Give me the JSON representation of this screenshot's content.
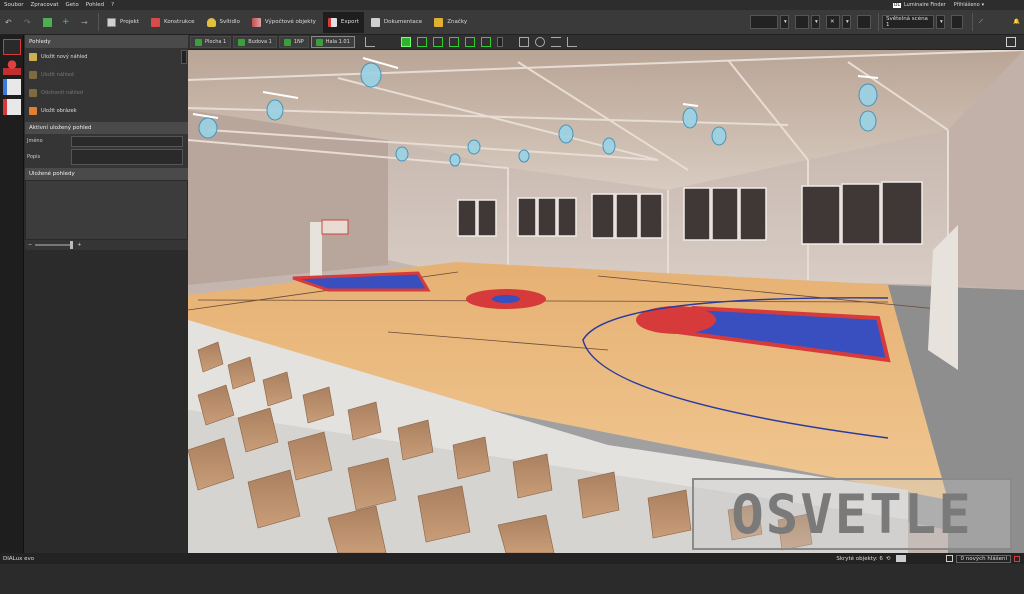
{
  "menu": {
    "items": [
      "Soubor",
      "Zpracovat",
      "Geto",
      "Pohled",
      "?"
    ]
  },
  "toolbar": {
    "tabs": [
      {
        "label": "Projekt",
        "icon": "project-icon",
        "color": "#d0d0d0"
      },
      {
        "label": "Konstrukce",
        "icon": "construction-icon",
        "color": "#d94a4a"
      },
      {
        "label": "Svítidlo",
        "icon": "luminaire-icon",
        "color": "#e0c040"
      },
      {
        "label": "Výpočtové objekty",
        "icon": "calc-objects-icon",
        "color": "#c05050"
      },
      {
        "label": "Export",
        "icon": "export-icon",
        "color": "#e0e0e0"
      },
      {
        "label": "Dokumentace",
        "icon": "documentation-icon",
        "color": "#cfcfcf"
      },
      {
        "label": "Značky",
        "icon": "markers-icon",
        "color": "#e0b030"
      }
    ],
    "active_tab": "Export",
    "luminaire_finder_logo": "DL",
    "luminaire_finder": "Luminaire Finder",
    "login": "Přihlášeno",
    "light_scene": "Světelná scéna 1"
  },
  "panel": {
    "views_header": "Pohledy",
    "items": [
      {
        "label": "Uložit nový náhled",
        "enabled": true,
        "color": "#d0b050"
      },
      {
        "label": "Uložit náhled",
        "enabled": false,
        "color": "#806a40"
      },
      {
        "label": "Odstranit náhled",
        "enabled": false,
        "color": "#806a40"
      },
      {
        "label": "Uložit obrázek",
        "enabled": true,
        "color": "#e08030"
      }
    ],
    "active_view_header": "Aktivní uložený pohled",
    "name_label": "Jméno",
    "desc_label": "Popis",
    "saved_views_header": "Uložené pohledy"
  },
  "viewbar": {
    "breadcrumbs": [
      {
        "label": "Plocha 1",
        "color": "#3aa03a"
      },
      {
        "label": "Budova 1",
        "color": "#3aa03a"
      },
      {
        "label": "1NP",
        "color": "#3aa03a"
      },
      {
        "label": "Hala 1.01",
        "color": "#3aa03a"
      }
    ]
  },
  "watermark": "OSVETLE",
  "status": {
    "app_name": "DIALux evo",
    "hidden_objects": "Skryté objekty: 6",
    "new_messages": "0 nových hlášení"
  },
  "colors": {
    "floor": "#e8b46e",
    "key": "#3a4fbf",
    "key_border": "#d63a3a",
    "wall": "#c9bbb3",
    "ceiling": "#cbb9aa",
    "seat": "#b88a62"
  }
}
